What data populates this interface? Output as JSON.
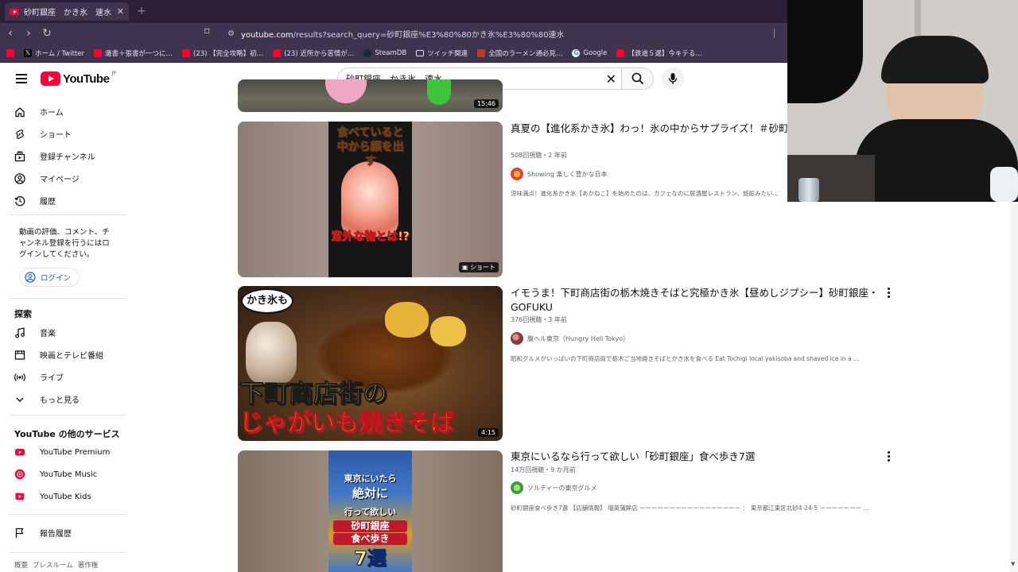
{
  "browser": {
    "tab_title": "砂町銀座　かき氷　速水 - YouTube",
    "url_domain": "youtube.com",
    "url_path": "/results?search_query=砂町銀座%E3%80%80かき氷%E3%80%80速水",
    "bookmarks": [
      {
        "label": "",
        "icon": "youtube",
        "color": "#ff0033"
      },
      {
        "label": "ホーム / Twitter",
        "icon": "x",
        "color": "#000000"
      },
      {
        "label": "遺書＋張書が一つに…",
        "icon": "youtube",
        "color": "#ff0033"
      },
      {
        "label": "(23) 【完全攻略】初…",
        "icon": "youtube",
        "color": "#ff0033"
      },
      {
        "label": "(23) 近所から苦情が…",
        "icon": "youtube",
        "color": "#ff0033"
      },
      {
        "label": "SteamDB",
        "icon": "steam",
        "color": "#1b2838"
      },
      {
        "label": "ツイッチ関連",
        "icon": "folder",
        "color": "#e5e1ea"
      },
      {
        "label": "全国のラーメン通必見…",
        "icon": "ramen",
        "color": "#c0392b"
      },
      {
        "label": "Google",
        "icon": "google",
        "color": "#4285f4"
      },
      {
        "label": "【鉄道５選】今キテる…",
        "icon": "youtube",
        "color": "#ff0033"
      }
    ]
  },
  "masthead": {
    "logo_text": "YouTube",
    "logo_region": "JP",
    "search_query": "砂町銀座　かき氷　速水"
  },
  "sidebar": {
    "main": [
      {
        "label": "ホーム",
        "icon": "home-icon"
      },
      {
        "label": "ショート",
        "icon": "shorts-icon"
      },
      {
        "label": "登録チャンネル",
        "icon": "subscriptions-icon"
      },
      {
        "label": "マイページ",
        "icon": "user-icon"
      },
      {
        "label": "履歴",
        "icon": "history-icon"
      }
    ],
    "signin_note": "動画の評価、コメント、チャンネル登録を行うにはログインしてください。",
    "login_label": "ログイン",
    "explore_heading": "探索",
    "explore": [
      {
        "label": "音楽",
        "icon": "music-icon"
      },
      {
        "label": "映画とテレビ番組",
        "icon": "film-icon"
      },
      {
        "label": "ライブ",
        "icon": "live-icon"
      },
      {
        "label": "もっと見る",
        "icon": "chevron-down-icon"
      }
    ],
    "services_heading": "YouTube の他のサービス",
    "services": [
      {
        "label": "YouTube Premium",
        "icon": "yt-premium-icon"
      },
      {
        "label": "YouTube Music",
        "icon": "yt-music-icon"
      },
      {
        "label": "YouTube Kids",
        "icon": "yt-kids-icon"
      }
    ],
    "report_label": "報告履歴",
    "footer": [
      "概要",
      "プレスルーム",
      "著作権"
    ]
  },
  "results": [
    {
      "duration": "15:46"
    },
    {
      "title": "真夏の【進化系かき氷】わっ！氷の中からサプライズ！＃砂町銀座 Shorts",
      "meta": "508回視聴・2 年前",
      "channel": "Showing 楽しく豊かな日本",
      "description": "涼味満点！進化系かき氷【あかねこ】を始めたのは、カフェなのに居酒屋レストラン、旅館みたい…",
      "badge": "ショート",
      "overlay_top": "食べていると中から顔を出す",
      "overlay_bottom": "意外な物とは!?"
    },
    {
      "title": "イモうま！下町商店街の栃木焼きそばと究極かき氷【昼めしジプシー】砂町銀座・GOFUKU",
      "meta": "376回視聴・3 年前",
      "channel": "腹ヘル東京（Hungry Hell Tokyo）",
      "description": "昭和グルメがいっぱいの下町商店街で栃木ご当地焼きそばとかき氷を食べる Eat Tochigi local yakisoba and shaved ice in a …",
      "duration": "4:15",
      "overlay_bubble": "かき氷も",
      "overlay_line1": "下町商店街の",
      "overlay_line2": "じゃがいも焼きそば"
    },
    {
      "title": "東京にいるなら行って欲しい「砂町銀座」食べ歩き7選",
      "meta": "14万回視聴・9 か月前",
      "channel": "ソルティーの東京グルメ",
      "description": "砂町銀座食べ歩き7選 【店舗情報】 増英蒲鉾店 ーーーーーーーーーーーーーーーーー ： 東京都江東区北砂4-24-5 ーーーーーーー …",
      "overlay_lines": [
        "東京にいたら",
        "絶対に",
        "行って欲しい",
        "砂町銀座",
        "食べ歩き",
        "7選"
      ]
    }
  ]
}
